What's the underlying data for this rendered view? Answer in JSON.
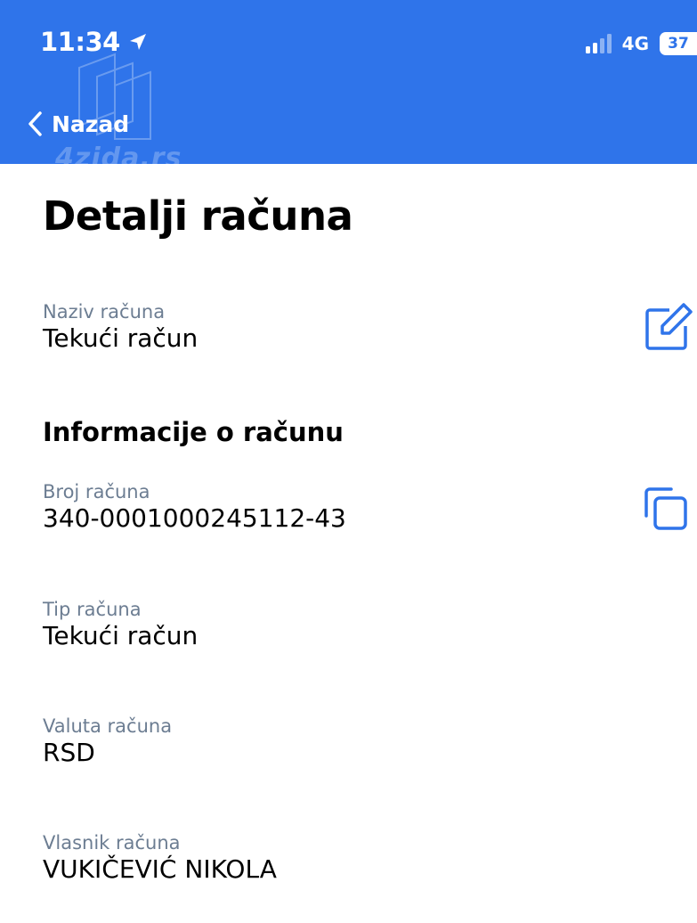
{
  "status_bar": {
    "time": "11:34",
    "network": "4G",
    "battery": "37"
  },
  "nav": {
    "back_label": "Nazad"
  },
  "watermark": {
    "text": "4zida.rs"
  },
  "page": {
    "title": "Detalji računa"
  },
  "account_name": {
    "label": "Naziv računa",
    "value": "Tekući račun",
    "action_icon": "edit-icon"
  },
  "account_info": {
    "heading": "Informacije o računu",
    "fields": [
      {
        "label": "Broj računa",
        "value": "340-0001000245112-43",
        "action_icon": "copy-icon"
      },
      {
        "label": "Tip računa",
        "value": "Tekući račun"
      },
      {
        "label": "Valuta računa",
        "value": "RSD"
      },
      {
        "label": "Vlasnik računa",
        "value": "VUKIČEVIĆ NIKOLA"
      }
    ]
  },
  "colors": {
    "header_bg": "#2f74ea",
    "accent": "#2f74ea",
    "label_gray": "#6c7d92"
  }
}
